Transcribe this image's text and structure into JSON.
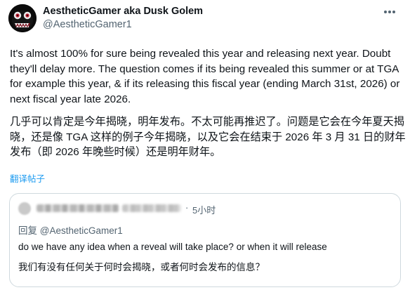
{
  "author": {
    "name": "AestheticGamer aka Dusk Golem",
    "handle": "@AestheticGamer1"
  },
  "post": {
    "text_en": "It's almost 100% for sure being revealed this year and releasing next year. Doubt they'll delay more. The question comes if its being revealed this summer or at TGA for example this year, & if its releasing this fiscal year (ending March 31st, 2026) or next fiscal year late 2026.",
    "text_zh": "几乎可以肯定是今年揭晓，明年发布。不太可能再推迟了。问题是它会在今年夏天揭晓，还是像 TGA 这样的例子今年揭晓，以及它会在结束于 2026 年 3 月 31 日的财年发布（即 2026 年晚些时候）还是明年财年。",
    "translate_label": "翻译帖子"
  },
  "quote": {
    "separator": "·",
    "time": "5小时",
    "reply_prefix": "回复",
    "reply_to": "@AestheticGamer1",
    "text_en": "do we have any idea when a reveal will take place? or when it will release",
    "text_zh": "我们有没有任何关于何时会揭晓，或者何时会发布的信息？"
  },
  "icons": {
    "more": "more-horizontal-icon",
    "avatar": "demon-face-avatar"
  },
  "colors": {
    "text_primary": "#0f1419",
    "text_secondary": "#536471",
    "link": "#1d9bf0",
    "border": "#cfd9de"
  }
}
